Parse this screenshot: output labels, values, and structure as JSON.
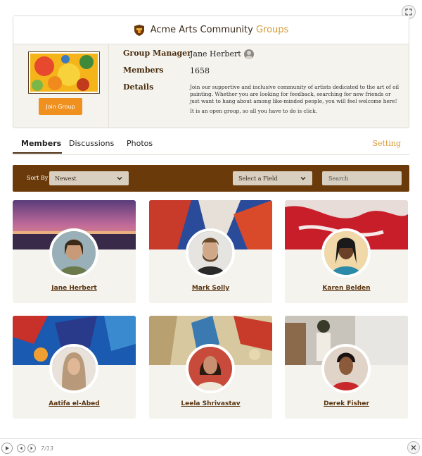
{
  "header": {
    "title_main": "Acme Arts Community",
    "title_accent": "Groups",
    "accent_color": "#d59a3a",
    "brand_color": "#6a3a0a"
  },
  "group": {
    "join_label": "Join Group",
    "manager_label": "Group Manager",
    "manager_name": "Jane Herbert",
    "members_label": "Members",
    "members_count": "1658",
    "details_label": "Details",
    "details_p1": "Join our supportive and inclusive community of artists dedicated to the art of oil painting. Whether you are looking for feedback, searching for new friends or just want to hang about among like-minded people, you will feel welcome here!",
    "details_p2": "It is an open group, so all you have to do is click."
  },
  "tabs": [
    {
      "label": "Members"
    },
    {
      "label": "Discussions"
    },
    {
      "label": "Photos"
    }
  ],
  "setting_label": "Setting",
  "filters": {
    "sort_by_label": "Sort By",
    "sort_value": "Newest",
    "field_value": "Select a Field",
    "search_placeholder": "Search"
  },
  "members": [
    {
      "name": "Jane Herbert"
    },
    {
      "name": "Mark Solly"
    },
    {
      "name": "Karen Belden"
    },
    {
      "name": "Aatifa el-Abed"
    },
    {
      "name": "Leela Shrivastav"
    },
    {
      "name": "Derek Fisher"
    }
  ],
  "player": {
    "page_indicator": "7/13"
  }
}
